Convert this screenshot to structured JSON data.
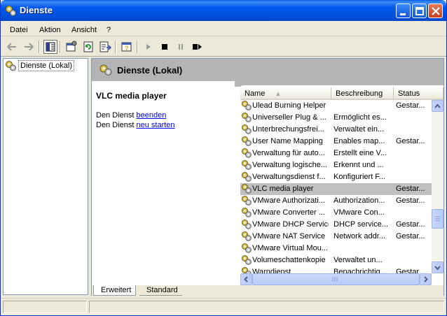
{
  "window": {
    "title": "Dienste"
  },
  "menu": {
    "items": [
      "Datei",
      "Aktion",
      "Ansicht",
      "?"
    ]
  },
  "tree": {
    "root_label": "Dienste (Lokal)"
  },
  "pane": {
    "header_title": "Dienste (Lokal)",
    "selected_service": "VLC media player",
    "stop_prefix": "Den Dienst",
    "stop_link": "beenden",
    "restart_prefix": "Den Dienst",
    "restart_link": "neu starten"
  },
  "list": {
    "columns": [
      "Name",
      "Beschreibung",
      "Status"
    ],
    "rows": [
      {
        "name": "Ulead Burning Helper",
        "desc": "",
        "status": "Gestar..."
      },
      {
        "name": "Universeller Plug & ...",
        "desc": "Ermöglicht es...",
        "status": ""
      },
      {
        "name": "Unterbrechungsfrei...",
        "desc": "Verwaltet ein...",
        "status": ""
      },
      {
        "name": "User Name Mapping",
        "desc": "Enables map...",
        "status": "Gestar..."
      },
      {
        "name": "Verwaltung für auto...",
        "desc": "Erstellt eine V...",
        "status": ""
      },
      {
        "name": "Verwaltung logische...",
        "desc": "Erkennt und ...",
        "status": ""
      },
      {
        "name": "Verwaltungsdienst f...",
        "desc": "Konfiguriert F...",
        "status": ""
      },
      {
        "name": "VLC media player",
        "desc": "",
        "status": "Gestar..."
      },
      {
        "name": "VMware Authorizati...",
        "desc": "Authorization...",
        "status": "Gestar..."
      },
      {
        "name": "VMware Converter ...",
        "desc": "VMware Con...",
        "status": ""
      },
      {
        "name": "VMware DHCP Service",
        "desc": "DHCP service...",
        "status": "Gestar..."
      },
      {
        "name": "VMware NAT Service",
        "desc": "Network addr...",
        "status": "Gestar..."
      },
      {
        "name": "VMware Virtual Mou...",
        "desc": "",
        "status": ""
      },
      {
        "name": "Volumeschattenkopie",
        "desc": "Verwaltet un...",
        "status": ""
      },
      {
        "name": "Warndienst",
        "desc": "Benachrichtig...",
        "status": "Gestar..."
      }
    ],
    "selected_index": 7
  },
  "tabs": [
    "Erweitert",
    "Standard"
  ],
  "colors": {
    "titlebar": "#0058ee",
    "selection": "#c0c0c0",
    "link": "#0000ee",
    "header_grey": "#b4b4b4"
  }
}
